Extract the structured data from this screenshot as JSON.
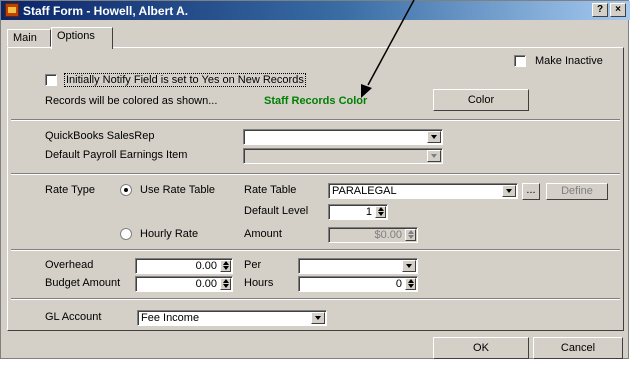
{
  "window": {
    "title": "Staff Form - Howell, Albert A.",
    "help_button": "?",
    "close_button": "×"
  },
  "tabs": [
    {
      "label": "Main",
      "active": false
    },
    {
      "label": "Options",
      "active": true
    }
  ],
  "make_inactive": {
    "label": "Make Inactive",
    "checked": false
  },
  "notify": {
    "label": "Initially Notify Field is set to Yes on New Records",
    "checked": false
  },
  "colors": {
    "label": "Records will be colored as shown...",
    "sample_text": "Staff Records Color",
    "sample_color": "#008000",
    "button_label": "Color"
  },
  "quickbooks": {
    "salesrep_label": "QuickBooks SalesRep",
    "salesrep_value": "",
    "payroll_label": "Default Payroll Earnings Item",
    "payroll_value": ""
  },
  "rate": {
    "type_label": "Rate Type",
    "use_rate_table_label": "Use Rate Table",
    "use_rate_table_selected": true,
    "rate_table_label": "Rate Table",
    "rate_table_value": "PARALEGAL",
    "browse_label": "...",
    "define_label": "Define",
    "default_level_label": "Default Level",
    "default_level_value": "1",
    "hourly_rate_label": "Hourly Rate",
    "hourly_rate_selected": false,
    "amount_label": "Amount",
    "amount_value": "$0.00"
  },
  "budget": {
    "overhead_label": "Overhead",
    "overhead_value": "0.00",
    "per_label": "Per",
    "per_value": "",
    "budget_amount_label": "Budget Amount",
    "budget_amount_value": "0.00",
    "hours_label": "Hours",
    "hours_value": "0"
  },
  "gl": {
    "label": "GL Account",
    "value": "Fee Income"
  },
  "footer": {
    "ok_label": "OK",
    "cancel_label": "Cancel"
  }
}
